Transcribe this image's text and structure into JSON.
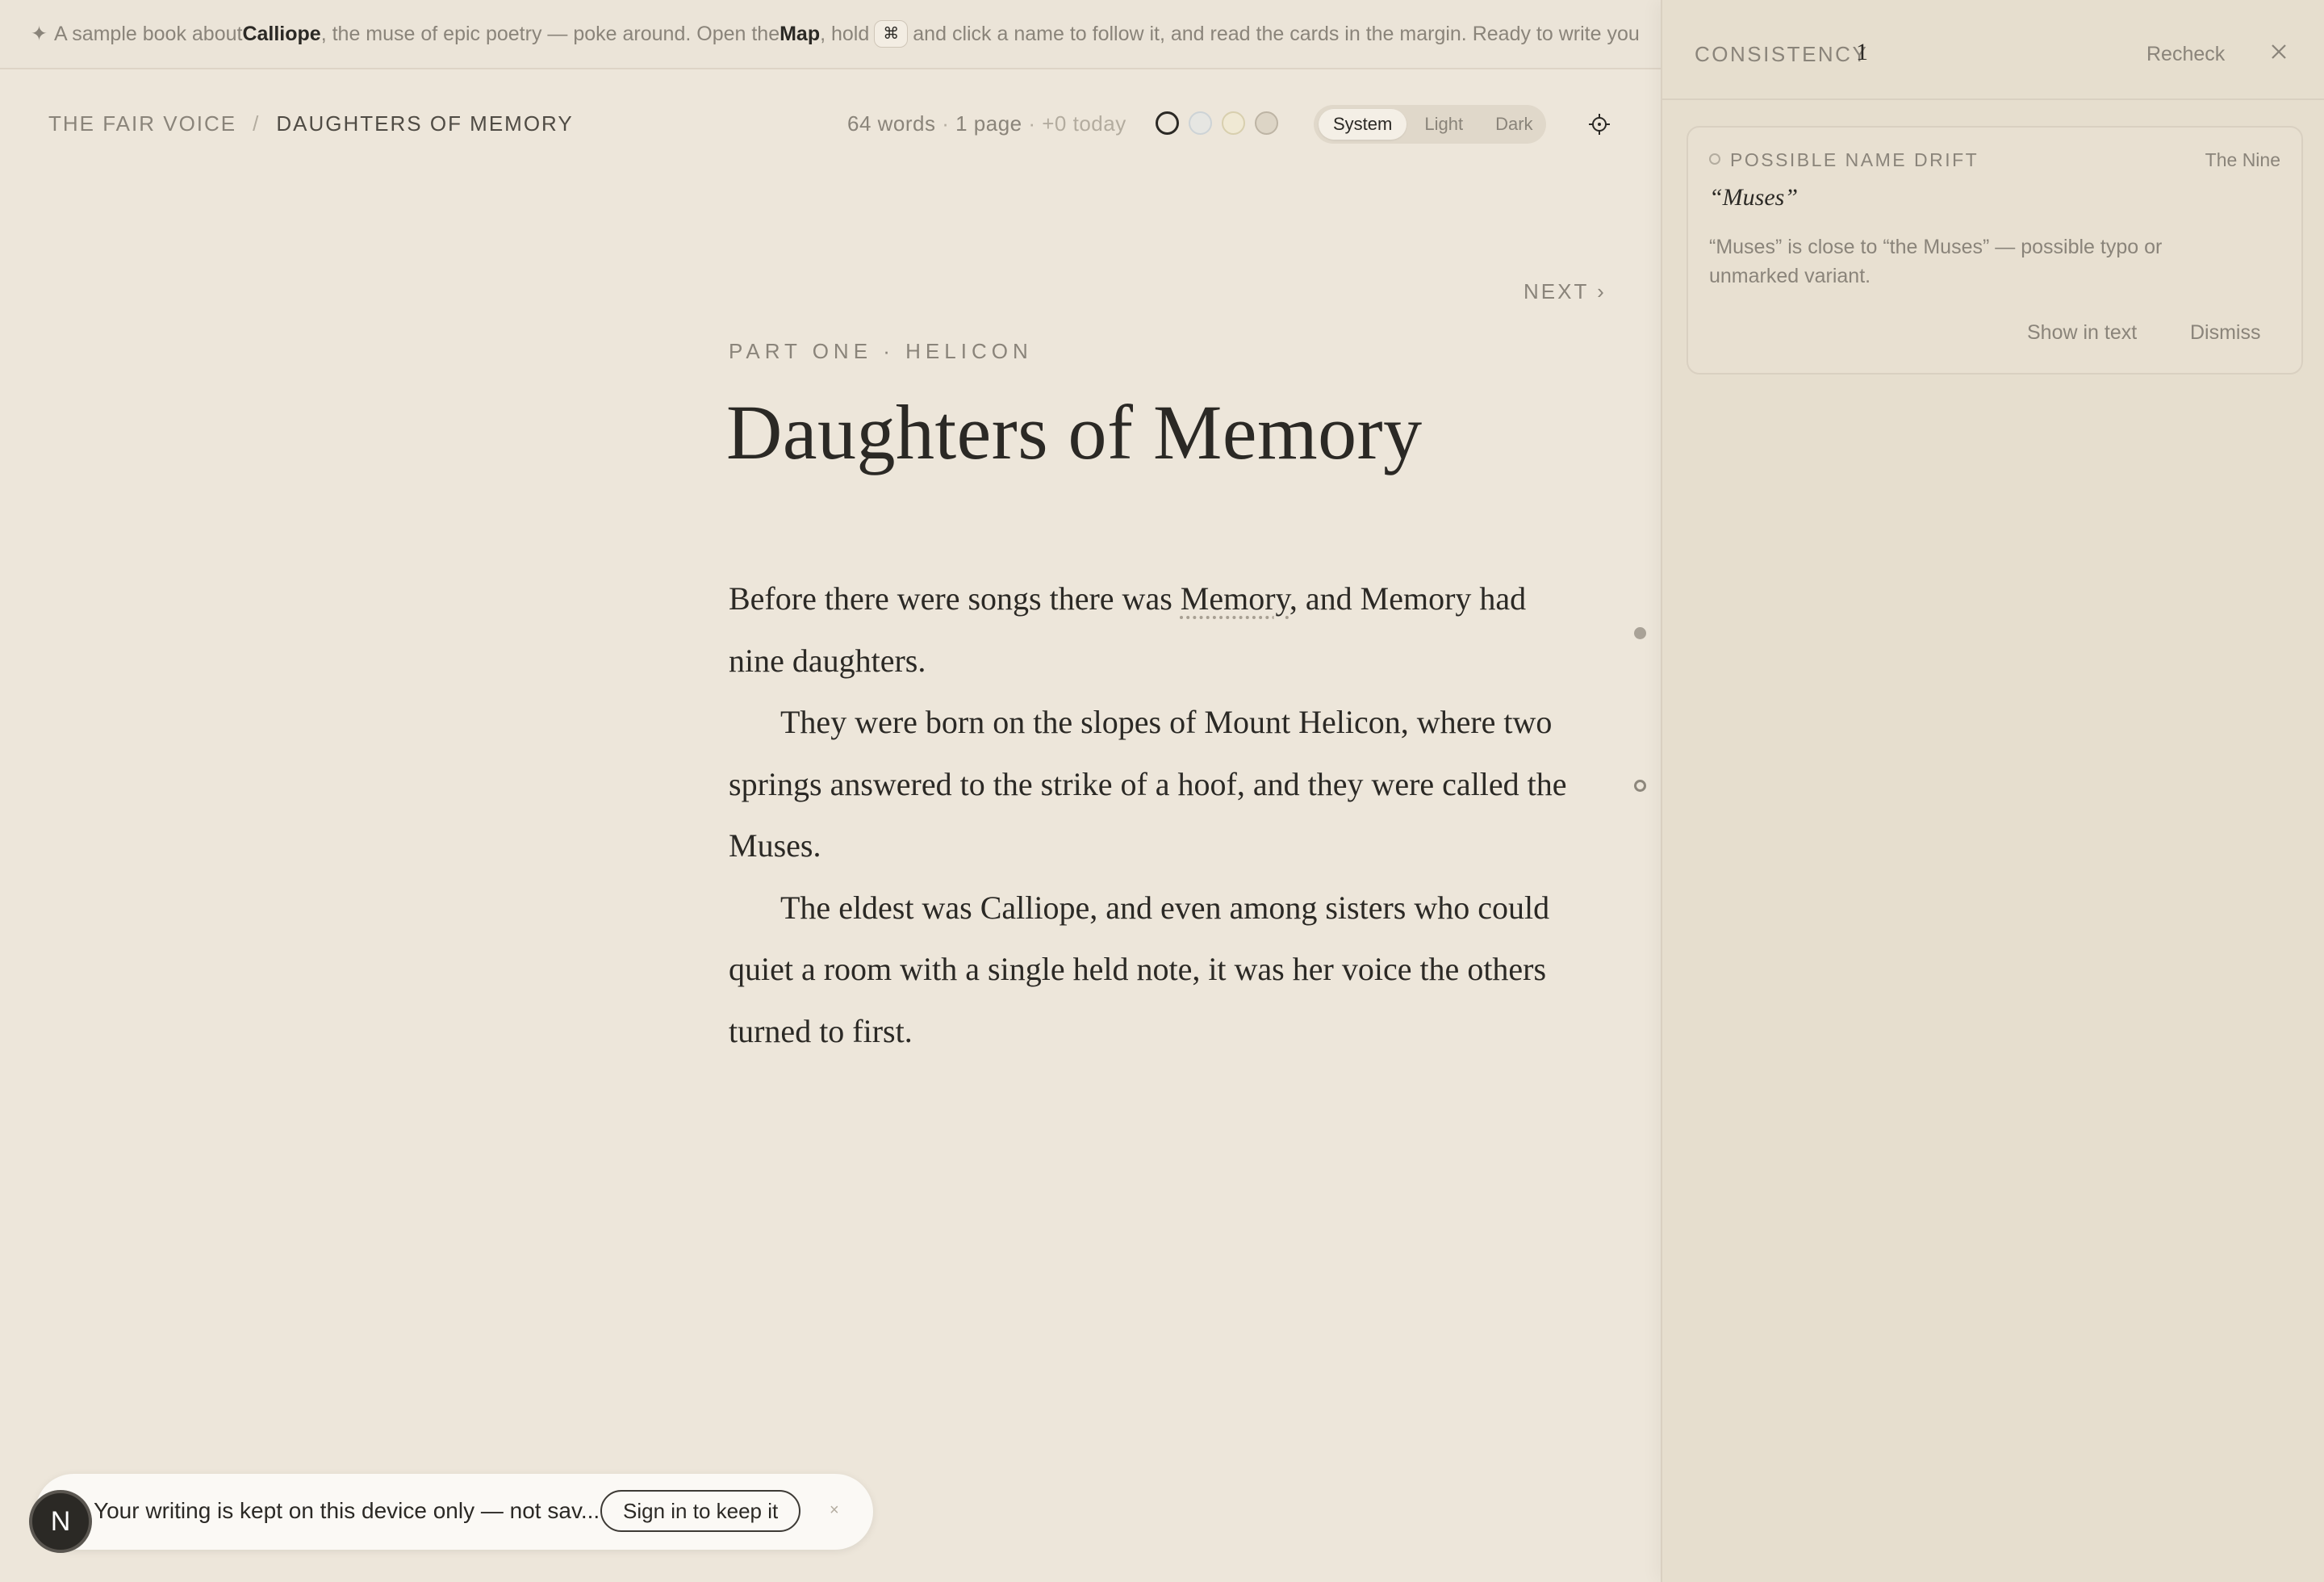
{
  "banner": {
    "part1": "A sample book about ",
    "name": "Calliope",
    "part2": ", the muse of epic poetry — poke around. Open the ",
    "map": "Map",
    "part3": ", hold ",
    "key": "⌘",
    "part4": " and click a name to follow it, and read the cards in the margin. Ready to write you"
  },
  "breadcrumb": {
    "book": "THE FAIR VOICE",
    "separator": "/",
    "chapter": "DAUGHTERS OF MEMORY"
  },
  "stats": {
    "words": "64 words",
    "sep1": " · ",
    "pages": "1 page",
    "sep2": " · ",
    "today": "+0 today"
  },
  "theme": {
    "options": [
      "System",
      "Light",
      "Dark"
    ],
    "selected": "System"
  },
  "nav": {
    "next": "NEXT ›"
  },
  "chapter": {
    "part": "PART ONE · HELICON",
    "title": "Daughters of Memory",
    "p1_before": "Before there were songs there was ",
    "p1_link": "Memory",
    "p1_after": ", and Memory had nine daughters.",
    "p2": "They were born on the slopes of Mount Helicon, where two springs answered to the strike of a hoof, and they were called the Muses.",
    "p3": "The eldest was Calliope, and even among sisters who could quiet a room with a single held note, it was her voice the others turned to first."
  },
  "panel": {
    "title": "CONSISTENCY",
    "count": "1",
    "recheck": "Recheck",
    "card": {
      "kind": "POSSIBLE NAME DRIFT",
      "tag": "The Nine",
      "term": "“Muses”",
      "description": "“Muses” is close to “the Muses” — possible typo or unmarked variant.",
      "show": "Show in text",
      "dismiss": "Dismiss"
    }
  },
  "toast": {
    "avatar": "N",
    "message": "Your writing is kept on this device only — not sav...",
    "button": "Sign in to keep it",
    "close": "×"
  },
  "colors": {
    "background": "#ede6da",
    "panel": "#e6dece",
    "text": "#2b2925",
    "muted": "#8a847a"
  }
}
